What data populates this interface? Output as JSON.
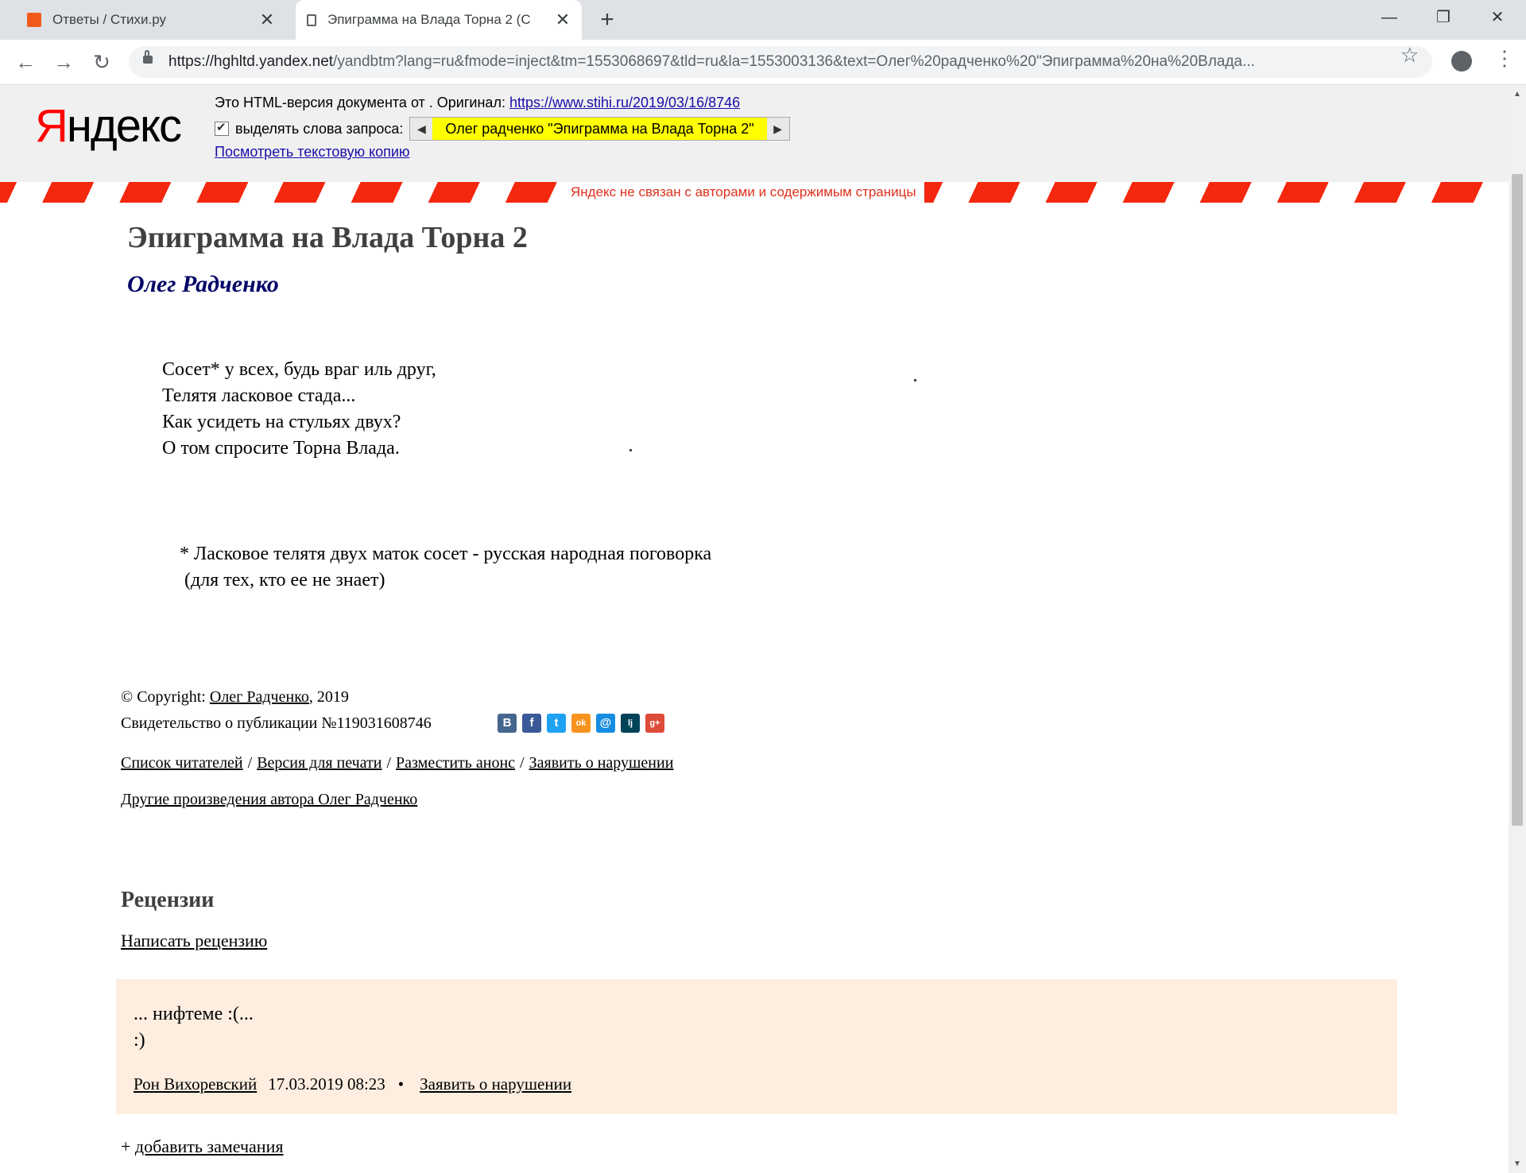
{
  "browser": {
    "tabs": [
      {
        "title": "Ответы / Стихи.ру"
      },
      {
        "title": "Эпиграмма на Влада Торна 2 (С"
      }
    ],
    "url_host": "https://hghltd.yandex.net",
    "url_rest": "/yandbtm?lang=ru&fmode=inject&tm=1553068697&tld=ru&la=1553003136&text=Олег%20радченко%20\"Эпиграмма%20на%20Влада..."
  },
  "yandex": {
    "logo": "Яндекс",
    "info_prefix": "Это HTML-версия документа от . Оригинал: ",
    "original_link": "https://www.stihi.ru/2019/03/16/8746",
    "highlight_label": "выделять слова запроса:",
    "highlight_query": "Олег радченко \"Эпиграмма на Влада Торна 2\"",
    "text_copy_link": "Посмотреть текстовую копию",
    "disclaimer": "Яндекс не связан с авторами и содержимым страницы"
  },
  "poem": {
    "title": "Эпиграмма на Влада Торна 2",
    "author": "Олег Радченко",
    "text": "Сосет* у всех, будь враг иль друг,\nТелятя ласковое стада...\nКак усидеть на стульях двух?\nО том спросите Торна Влада.",
    "footnote": "* Ласковое телятя двух маток сосет - русская народная поговорка\n (для тех, кто ее не знает)"
  },
  "footer": {
    "copyright_prefix": "© Copyright: ",
    "copyright_author": "Олег Радченко",
    "copyright_year": ", 2019",
    "certificate": "Свидетельство о публикации №119031608746",
    "links": [
      "Список читателей",
      "Версия для печати",
      "Разместить анонс",
      "Заявить о нарушении"
    ],
    "other_works": "Другие произведения автора Олег Радченко"
  },
  "reviews": {
    "heading": "Рецензии",
    "write_link": "Написать рецензию",
    "items": [
      {
        "text": "... нифтеме :(...\n:)",
        "author": "Рон Вихоревский",
        "date": "17.03.2019 08:23",
        "bullet": "•",
        "report": "Заявить о нарушении"
      }
    ],
    "add_prefix": "+ ",
    "add_link": "добавить замечания"
  },
  "icons": {
    "share": [
      "В",
      "f",
      "t",
      "ok",
      "@",
      "lj",
      "g+"
    ],
    "share_colors": [
      "#45668e",
      "#3b5998",
      "#1da1f2",
      "#f7931e",
      "#168de2",
      "#004359",
      "#dd4b39"
    ]
  }
}
